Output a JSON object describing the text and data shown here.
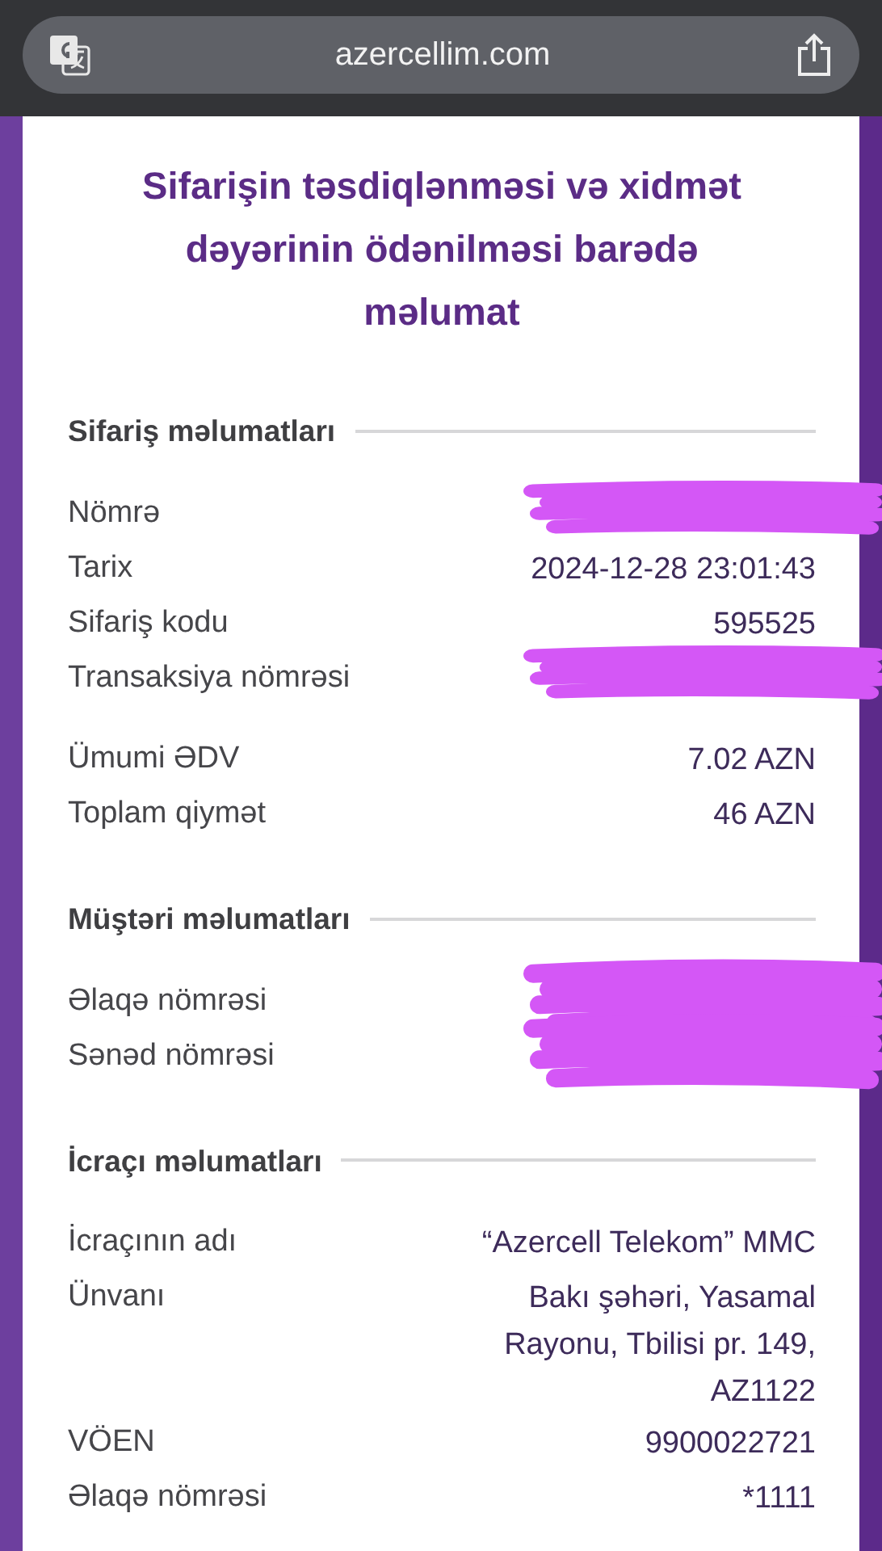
{
  "browser": {
    "url": "azercellim.com"
  },
  "title": "Sifarişin təsdiqlənməsi və xidmət dəyərinin ödənilməsi barədə məlumat",
  "sections": [
    {
      "heading": "Sifariş məlumatları",
      "groups": [
        [
          {
            "label": "Nömrə",
            "redacted": true
          },
          {
            "label": "Tarix",
            "value": "2024-12-28 23:01:43",
            "redacted": false
          },
          {
            "label": "Sifariş kodu",
            "value": "595525",
            "redacted": false
          },
          {
            "label": "Transaksiya nömrəsi",
            "redacted": true
          }
        ],
        [
          {
            "label": "Ümumi ƏDV",
            "value": "7.02 AZN",
            "redacted": false
          },
          {
            "label": "Toplam qiymət",
            "value": "46 AZN",
            "redacted": false
          }
        ]
      ]
    },
    {
      "heading": "Müştəri məlumatları",
      "groups": [
        [
          {
            "label": "Əlaqə nömrəsi",
            "redacted": true
          },
          {
            "label": "Sənəd nömrəsi",
            "redacted": true
          }
        ]
      ]
    },
    {
      "heading": "İcraçı məlumatları",
      "groups": [
        [
          {
            "label": "İcraçının adı",
            "value": "“Azercell Telekom” MMC",
            "redacted": false
          },
          {
            "label": "Ünvanı",
            "value": "Bakı şəhəri, Yasamal Rayonu, Tbilisi pr. 149, AZ1122",
            "redacted": false
          },
          {
            "label": "VÖEN",
            "value": "9900022721",
            "redacted": false
          },
          {
            "label": "Əlaqə nömrəsi",
            "value": "*1111",
            "redacted": false
          }
        ]
      ]
    }
  ]
}
